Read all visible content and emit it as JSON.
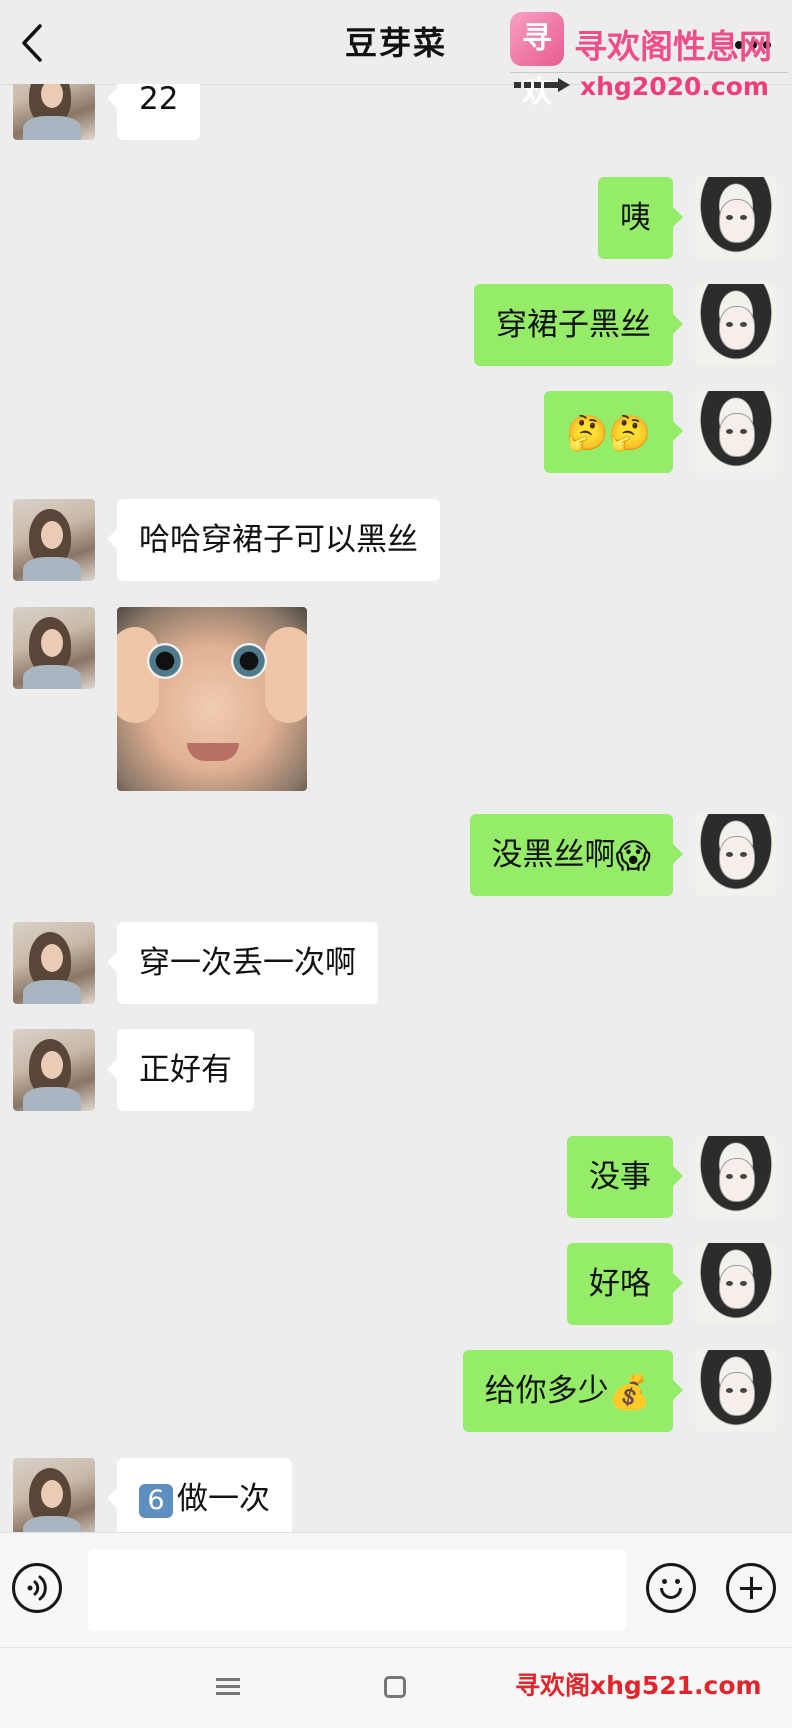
{
  "header": {
    "title": "豆芽菜",
    "back_icon": "chevron-left-icon",
    "more_icon": "more-dots-icon"
  },
  "watermark_top": {
    "logo_text": "寻欢",
    "name": "寻欢阁性息网",
    "url": "xhg2020.com",
    "color": "#ee4f8a"
  },
  "messages": [
    {
      "side": "left",
      "text": "22"
    },
    {
      "side": "right",
      "text": "咦"
    },
    {
      "side": "right",
      "text": "穿裙子黑丝"
    },
    {
      "side": "right",
      "text": "",
      "emoji": "🤔🤔"
    },
    {
      "side": "left",
      "text": "哈哈穿裙子可以黑丝"
    },
    {
      "side": "left",
      "type": "image",
      "image_desc": "baby-face-sticker"
    },
    {
      "side": "right",
      "text": "没黑丝啊",
      "emoji": "😱"
    },
    {
      "side": "left",
      "text": "穿一次丢一次啊"
    },
    {
      "side": "left",
      "text": "正好有"
    },
    {
      "side": "right",
      "text": "没事"
    },
    {
      "side": "right",
      "text": "好咯"
    },
    {
      "side": "right",
      "text": "给你多少",
      "emoji": "💰"
    },
    {
      "side": "left",
      "keycap": "6",
      "text": "做一次"
    }
  ],
  "input_bar": {
    "voice_icon": "voice-icon",
    "emoji_icon": "emoji-icon",
    "plus_icon": "plus-icon",
    "input_value": ""
  },
  "colors": {
    "background": "#ededed",
    "my_bubble": "#95ec69",
    "their_bubble": "#ffffff"
  },
  "watermark_bottom": {
    "text": "寻欢阁xhg521.com",
    "color": "#e0262c"
  }
}
